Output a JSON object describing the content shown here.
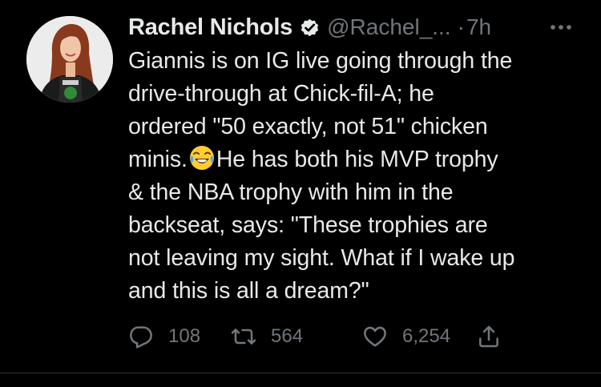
{
  "tweet": {
    "author_name": "Rachel Nichols",
    "handle": "@Rachel_...",
    "separator": "·",
    "time": "7h",
    "text_lines": [
      "Giannis is on IG live going through the",
      "drive-through at Chick-fil-A; he",
      "ordered \"50 exactly, not 51\" chicken",
      "minis.",
      "He has both his MVP trophy",
      "& the NBA trophy with him in the",
      "backseat, says: \"These trophies are",
      "not leaving my sight. What if I wake up",
      "and this is all a dream?\""
    ],
    "emoji": "face-with-tears-of-joy-emoji"
  },
  "actions": {
    "replies": "108",
    "retweets": "564",
    "likes": "6,254"
  },
  "icons": {
    "verified": "verified-badge-icon",
    "more": "more-options-icon",
    "reply": "reply-icon",
    "retweet": "retweet-icon",
    "like": "heart-icon",
    "share": "share-icon"
  },
  "colors": {
    "background": "#000000",
    "text_primary": "#e7e9ea",
    "text_secondary": "#71767b"
  }
}
